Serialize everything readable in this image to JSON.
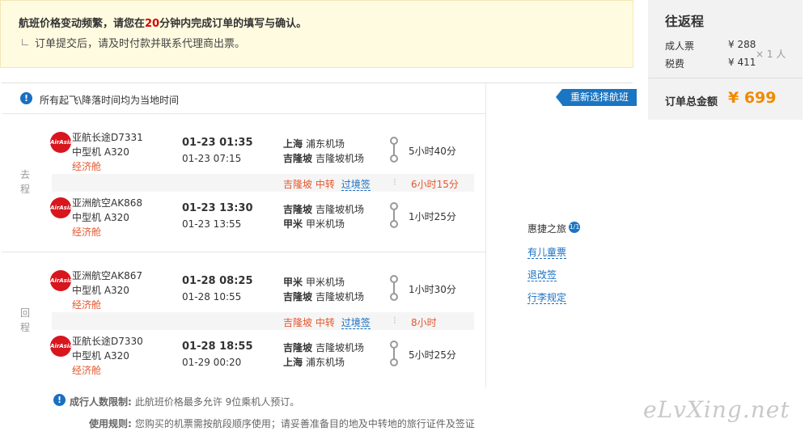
{
  "notice": {
    "line1_pre": "航班价格变动频繁，请您在",
    "line1_minutes": "20",
    "line1_post": "分钟内完成订单的填写与确认。",
    "line2": "订单提交后，请及时付款并联系代理商出票。"
  },
  "price": {
    "title": "往返程",
    "adult_label": "成人票",
    "adult_amount": "¥ 288",
    "tax_label": "税费",
    "tax_amount": "¥ 411",
    "multiplier": "× 1 人",
    "total_label": "订单总金额",
    "total_value": "¥ 699"
  },
  "info_bar": {
    "icon": "!",
    "text": "所有起飞\\降落时间均为当地时间"
  },
  "reselect_label": "重新选择航班",
  "outbound": {
    "label_1": "去",
    "label_2": "程",
    "flights": [
      {
        "logo_text": "AirAsia",
        "airline": "亚航长途D7331",
        "aircraft": "中型机 A320",
        "cabin": "经济舱",
        "dep_time": "01-23 01:35",
        "arr_time": "01-23 07:15",
        "dep_city": "上海",
        "dep_airport": "浦东机场",
        "arr_city": "吉隆坡",
        "arr_airport": "吉隆坡机场",
        "duration": "5小时40分"
      },
      {
        "logo_text": "AirAsia",
        "airline": "亚洲航空AK868",
        "aircraft": "中型机 A320",
        "cabin": "经济舱",
        "dep_time": "01-23 13:30",
        "arr_time": "01-23 13:55",
        "dep_city": "吉隆坡",
        "dep_airport": "吉隆坡机场",
        "arr_city": "甲米",
        "arr_airport": "甲米机场",
        "duration": "1小时25分"
      }
    ],
    "transfer": {
      "city": "吉隆坡",
      "label": "中转",
      "link": "过境签",
      "duration": "6小时15分"
    }
  },
  "return": {
    "label_1": "回",
    "label_2": "程",
    "flights": [
      {
        "logo_text": "AirAsia",
        "airline": "亚洲航空AK867",
        "aircraft": "中型机 A320",
        "cabin": "经济舱",
        "dep_time": "01-28 08:25",
        "arr_time": "01-28 10:55",
        "dep_city": "甲米",
        "dep_airport": "甲米机场",
        "arr_city": "吉隆坡",
        "arr_airport": "吉隆坡机场",
        "duration": "1小时30分"
      },
      {
        "logo_text": "AirAsia",
        "airline": "亚航长途D7330",
        "aircraft": "中型机 A320",
        "cabin": "经济舱",
        "dep_time": "01-28 18:55",
        "arr_time": "01-29 00:20",
        "dep_city": "吉隆坡",
        "dep_airport": "吉隆坡机场",
        "arr_city": "上海",
        "arr_airport": "浦东机场",
        "duration": "5小时25分"
      }
    ],
    "transfer": {
      "city": "吉隆坡",
      "label": "中转",
      "link": "过境签",
      "duration": "8小时"
    }
  },
  "side": {
    "title": "惠捷之旅",
    "badge": "1/1",
    "links": [
      "有儿童票",
      "退改签",
      "行李规定"
    ]
  },
  "rules": {
    "limit_label": "成行人数限制:",
    "limit_text": "此航班价格最多允许 9位乘机人预订。",
    "use_label": "使用规则:",
    "use_text": "您购买的机票需按航段顺序使用；请妥善准备目的地及中转地的旅行证件及签证"
  },
  "watermark": "eLvXing.net"
}
